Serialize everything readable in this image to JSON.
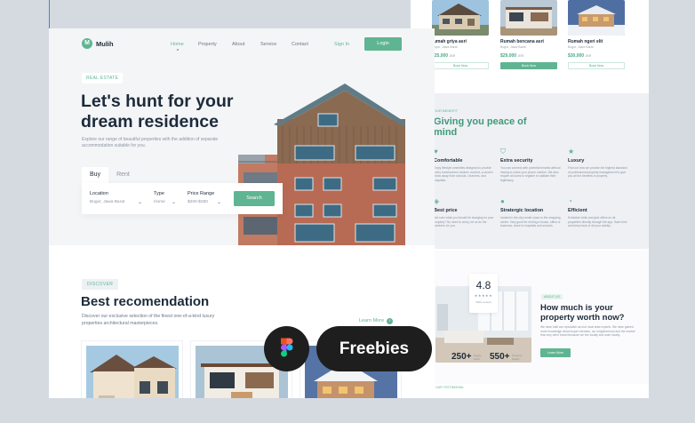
{
  "colors": {
    "accent": "#5fb592",
    "dark": "#1d2b3a",
    "muted": "#8b95a1",
    "background": "#d5dae1",
    "pill": "#1e1e1e"
  },
  "header": {
    "logo_letter": "M",
    "logo_name": "Mulih",
    "nav": [
      "Home",
      "Property",
      "About",
      "Service",
      "Contact"
    ],
    "active_nav": "Home",
    "signin": "Sign In",
    "login": "Login"
  },
  "hero": {
    "badge": "REAL ESTATE",
    "title": "Let's hunt for your dream residence",
    "subtitle": "Explore our range of beautiful properties with the addition of separate accommodation suitable for you.",
    "tabs": [
      "Buy",
      "Rent"
    ],
    "active_tab": "Buy",
    "search": {
      "location_label": "Location",
      "location_value": "Bogor, Jawa Barat",
      "type_label": "Type",
      "type_value": "Home",
      "price_label": "Price Range",
      "price_value": "$200-$350",
      "button": "Search"
    }
  },
  "recommend": {
    "badge": "DISCOVER",
    "title": "Best recomendation",
    "subtitle": "Discover our exclusive selection of the finest one-of-a-kind luxury properties architectural masterpieces.",
    "learn_more": "Learn More"
  },
  "listings": [
    {
      "name": "rumah griya asri",
      "sub": "Bogor, Jawa Barat",
      "price": "$25,000",
      "tag": "2BR",
      "button": "Book Now"
    },
    {
      "name": "Rumah bencana asri",
      "sub": "Bogor, Jawa Barat",
      "price": "$29,000",
      "tag": "2BR",
      "button": "Book Now"
    },
    {
      "name": "Rumah ngeri elit",
      "sub": "Bogor, Jawa Barat",
      "price": "$30,000",
      "tag": "2BR",
      "button": "Book Now"
    }
  ],
  "peace": {
    "tag": "OUR BENEFIT",
    "title": "Giving you peace of mind",
    "features": [
      {
        "title": "Comfortable",
        "icon": "heart-icon",
        "desc": "Enjoy lifestyle amenities designed to provide every homeowners modern comfort, a stone's throw away from schools, churches, and hospitals."
      },
      {
        "title": "Extra security",
        "icon": "shield-icon",
        "desc": "You can connect with potential tenants without having to share your phone number. We also require all users to register to validate their legitimacy."
      },
      {
        "title": "Luxury",
        "icon": "star-icon",
        "desc": "Find out how we provide the highest standard of professional property management to give you all the benefits of property."
      },
      {
        "title": "Best price",
        "icon": "tag-icon",
        "desc": "Not sure what you should be charging for your property? No need to worry, let us do the numbers for you."
      },
      {
        "title": "Stratergic location",
        "icon": "pin-icon",
        "desc": "located in the city center close to the shopping center. Very good for renting a house, office or business, close to hospitals and schools."
      },
      {
        "title": "Efficient",
        "icon": "chart-icon",
        "desc": "Schedule visits and give offers on all properties directly through the app. Save time and keep track of all your activity."
      }
    ]
  },
  "worth": {
    "rating": "4.8",
    "stars": "★★★★★",
    "rating_label": "5000 reviews",
    "stat_one": "250+",
    "stat_one_label": "Happy client",
    "stat_two": "550+",
    "stat_two_label": "Property Ready",
    "tag": "ABOUT US",
    "title": "How much is your property worth now?",
    "desc": "We have built our reputation as true local area experts. We have gained more knowledge about buyer interests, our neighborhood and the market than any other brand because we live locally and work locally.",
    "button": "Learn More",
    "lower_tag": "OUR TESTIMONIAL"
  },
  "pill": {
    "label": "Freebies"
  }
}
